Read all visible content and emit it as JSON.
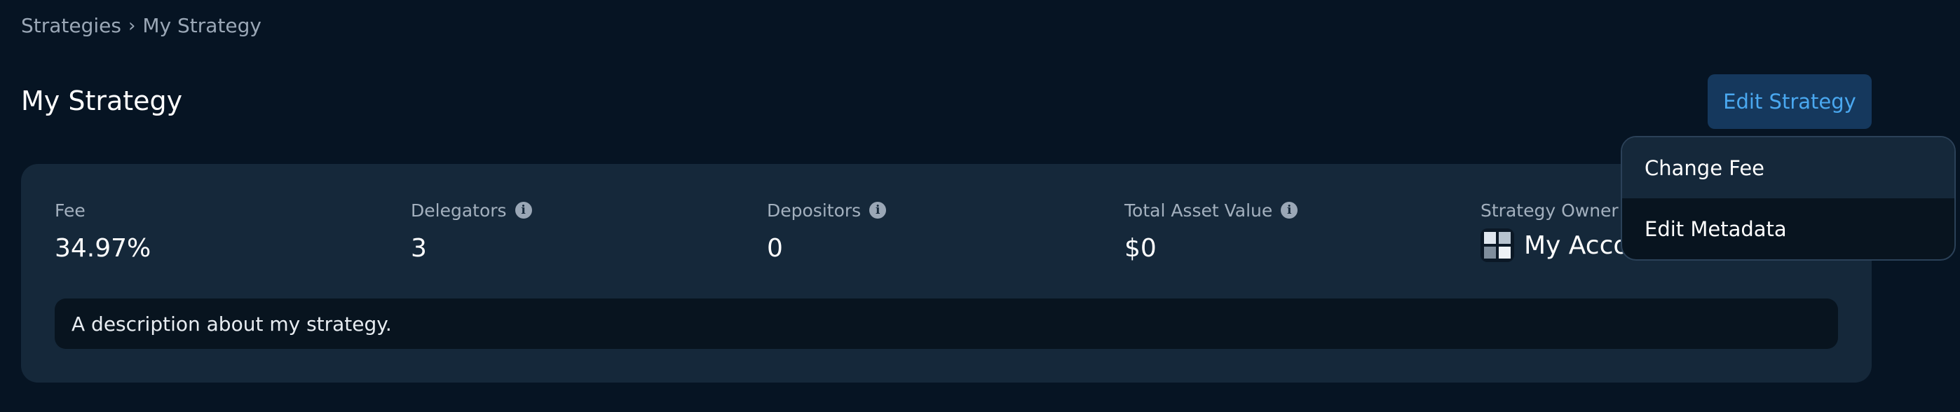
{
  "breadcrumb": {
    "items": [
      "Strategies",
      "My Strategy"
    ],
    "separator": "›"
  },
  "page_title": "My Strategy",
  "edit_button_label": "Edit Strategy",
  "stats": {
    "fee": {
      "label": "Fee",
      "value": "34.97%"
    },
    "delegators": {
      "label": "Delegators",
      "value": "3"
    },
    "depositors": {
      "label": "Depositors",
      "value": "0"
    },
    "total_asset_value": {
      "label": "Total Asset Value",
      "value": "$0"
    },
    "strategy_owner": {
      "label": "Strategy Owner",
      "value": "My Acco"
    }
  },
  "info_icon_glyph": "i",
  "description": "A description about my strategy.",
  "dropdown": {
    "items": [
      {
        "label": "Change Fee"
      },
      {
        "label": "Edit Metadata"
      }
    ]
  },
  "colors": {
    "background": "#061423",
    "card": "#15283a",
    "accent": "#4aa8f0",
    "button_bg": "#15385d"
  }
}
